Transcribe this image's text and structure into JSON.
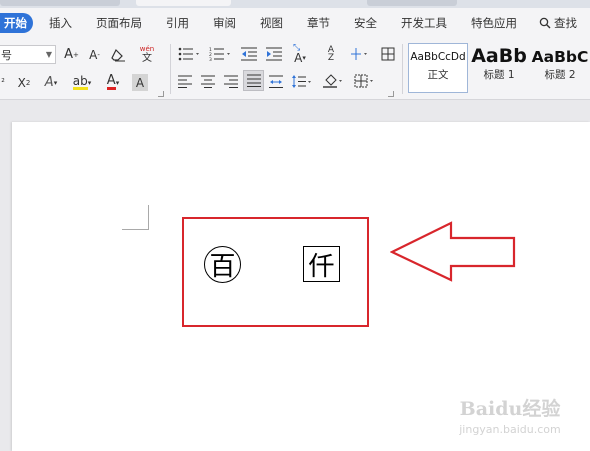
{
  "menu": {
    "items": [
      "开始",
      "插入",
      "页面布局",
      "引用",
      "审阅",
      "视图",
      "章节",
      "安全",
      "开发工具",
      "特色应用",
      "查找"
    ]
  },
  "ribbon": {
    "font_size_value": "号",
    "styles": [
      {
        "preview": "AaBbCcDd",
        "label": "正文"
      },
      {
        "preview": "AaBb",
        "label": "标题 1"
      },
      {
        "preview": "AaBbC",
        "label": "标题 2"
      }
    ]
  },
  "document": {
    "enclosed_chars": [
      "百",
      "仟"
    ]
  },
  "watermark": {
    "brand": "Baidu经验",
    "url": "jingyan.baidu.com"
  },
  "colors": {
    "accent": "#2f73d8",
    "highlight_box": "#d8262c",
    "watermark": "#d3d3d3"
  }
}
